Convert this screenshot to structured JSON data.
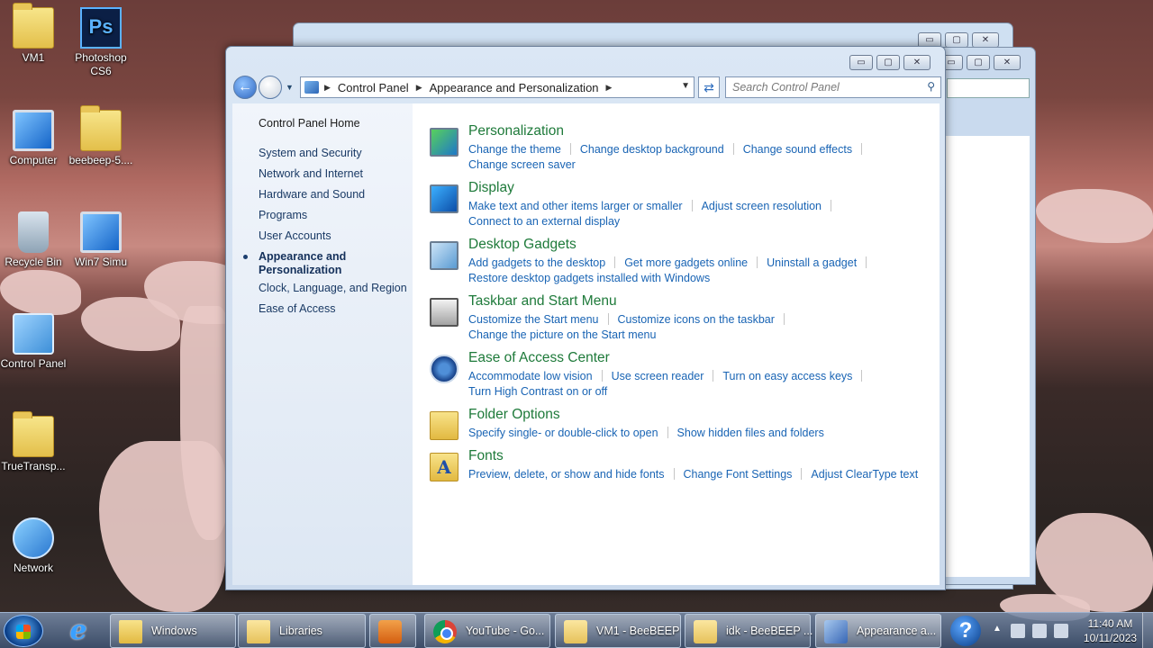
{
  "desktop": {
    "icons": [
      {
        "label": "VM1"
      },
      {
        "label": "Photoshop CS6"
      },
      {
        "label": "Computer"
      },
      {
        "label": "beebeep-5...."
      },
      {
        "label": "Recycle Bin"
      },
      {
        "label": "Win7 Simu"
      },
      {
        "label": "Control Panel"
      },
      {
        "label": "TrueTransp..."
      },
      {
        "label": "Network"
      }
    ],
    "ps_glyph": "Ps"
  },
  "window": {
    "breadcrumb": [
      "Control Panel",
      "Appearance and Personalization"
    ],
    "search_placeholder": "Search Control Panel",
    "controls": {
      "minimize": "▭",
      "maximize": "▢",
      "close": "✕"
    }
  },
  "left_pane": {
    "home": "Control Panel Home",
    "items": [
      "System and Security",
      "Network and Internet",
      "Hardware and Sound",
      "Programs",
      "User Accounts",
      "Appearance and Personalization",
      "Clock, Language, and Region",
      "Ease of Access"
    ],
    "active_index": 5
  },
  "categories": [
    {
      "title": "Personalization",
      "icon": "personalization-icon",
      "links": [
        "Change the theme",
        "Change desktop background",
        "Change sound effects",
        "Change screen saver"
      ]
    },
    {
      "title": "Display",
      "icon": "display-icon",
      "links": [
        "Make text and other items larger or smaller",
        "Adjust screen resolution",
        "Connect to an external display"
      ]
    },
    {
      "title": "Desktop Gadgets",
      "icon": "gadgets-icon",
      "links": [
        "Add gadgets to the desktop",
        "Get more gadgets online",
        "Uninstall a gadget",
        "Restore desktop gadgets installed with Windows"
      ]
    },
    {
      "title": "Taskbar and Start Menu",
      "icon": "taskbar-icon",
      "links": [
        "Customize the Start menu",
        "Customize icons on the taskbar",
        "Change the picture on the Start menu"
      ]
    },
    {
      "title": "Ease of Access Center",
      "icon": "ease-of-access-icon",
      "links": [
        "Accommodate low vision",
        "Use screen reader",
        "Turn on easy access keys",
        "Turn High Contrast on or off"
      ]
    },
    {
      "title": "Folder Options",
      "icon": "folder-options-icon",
      "links": [
        "Specify single- or double-click to open",
        "Show hidden files and folders"
      ]
    },
    {
      "title": "Fonts",
      "icon": "fonts-icon",
      "links": [
        "Preview, delete, or show and hide fonts",
        "Change Font Settings",
        "Adjust ClearType text"
      ]
    }
  ],
  "fonts_glyph": "A",
  "taskbar": {
    "tasks": [
      {
        "label": "Windows"
      },
      {
        "label": "Libraries"
      },
      {
        "label": "YouTube - Go..."
      },
      {
        "label": "VM1 - BeeBEEP"
      },
      {
        "label": "idk - BeeBEEP ..."
      },
      {
        "label": "Appearance a..."
      }
    ],
    "ie_glyph": "e",
    "help_glyph": "?",
    "clock_time": "11:40 AM",
    "clock_date": "10/11/2023"
  }
}
